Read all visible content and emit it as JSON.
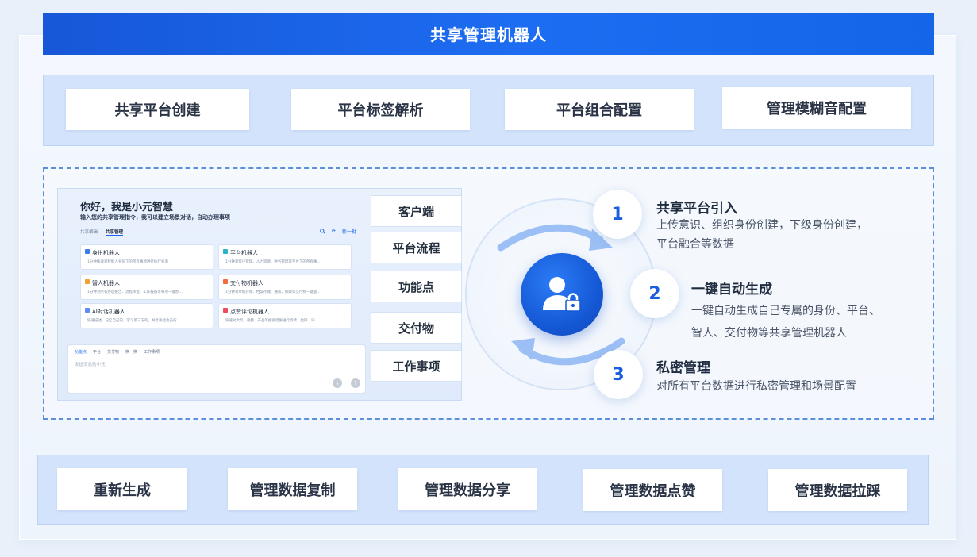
{
  "title": "共享管理机器人",
  "top_features": [
    "共享平台创建",
    "平台标签解析",
    "平台组合配置",
    "管理模糊音配置"
  ],
  "bottom_features": [
    "重新生成",
    "管理数据复制",
    "管理数据分享",
    "管理数据点赞",
    "管理数据拉踩"
  ],
  "mockup": {
    "greeting": "你好，我是小元智慧",
    "subtitle": "输入您的共享管理指令，我可以建立场景对话，自动办理事项",
    "tabs": [
      "共享编辑",
      "共享管理"
    ],
    "right_action": "新一批",
    "cards": [
      {
        "title": "身份机器人",
        "desc": "1分钟快速对智能人身份下的所有事项进行执行查询"
      },
      {
        "title": "平台机器人",
        "desc": "1分钟对客户管理、人力资源、财务管理等平台下的所有事..."
      },
      {
        "title": "智人机器人",
        "desc": "1分钟对所有办理报告、流程审批、工作报备等事项一键办..."
      },
      {
        "title": "交付物机器人",
        "desc": "1分钟对本机存储、档案存储、通讯、依赖等交付物一键查..."
      },
      {
        "title": "AI对话机器人",
        "desc": "快速描述、记忆自己的、学习第三方的，共享再给会员的..."
      },
      {
        "title": "点赞评论机器人",
        "desc": "快速对文案、视频、产品等搜索结果进行点赞、拉踩、评..."
      }
    ],
    "toolbar": [
      "功能点",
      "平台",
      "交付物",
      "换一换",
      "工作事项"
    ],
    "input_placeholder": "发送消息给小元"
  },
  "side_tabs": [
    "客户端",
    "平台流程",
    "功能点",
    "交付物",
    "工作事项"
  ],
  "steps": [
    {
      "num": "1",
      "title": "共享平台引入",
      "desc_lines": [
        "上传意识、组织身份创建，下级身份创建，",
        "平台融合等数据"
      ]
    },
    {
      "num": "2",
      "title": "一键自动生成",
      "desc_lines": [
        "一键自动生成自己专属的身份、平台、",
        "智人、交付物等共享管理机器人"
      ]
    },
    {
      "num": "3",
      "title": "私密管理",
      "desc_lines": [
        "对所有平台数据进行私密管理和场景配置"
      ]
    }
  ],
  "icons": {
    "center": "user-lock-icon"
  },
  "colors": {
    "accent": "#1d64e8",
    "band": "#d3e3fb"
  }
}
